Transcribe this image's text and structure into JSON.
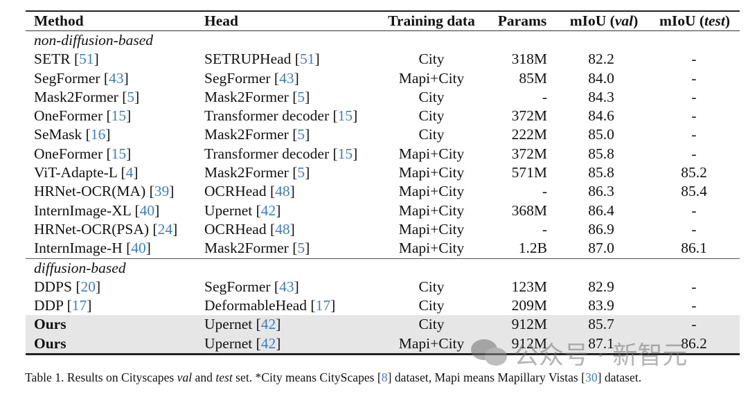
{
  "table": {
    "headers": {
      "method": "Method",
      "head": "Head",
      "training_data": "Training data",
      "params": "Params",
      "miou_val_prefix": "mIoU (",
      "miou_val_italic": "val",
      "miou_val_suffix": ")",
      "miou_test_prefix": "mIoU (",
      "miou_test_italic": "test",
      "miou_test_suffix": ")"
    },
    "groups": [
      {
        "label": "non-diffusion-based",
        "rows": [
          {
            "method": "SETR",
            "method_ref": "51",
            "head": "SETRUPHead",
            "head_ref": "51",
            "training_data": "City",
            "params": "318M",
            "miou_val": "82.2",
            "miou_test": "-"
          },
          {
            "method": "SegFormer",
            "method_ref": "43",
            "head": "SegFormer",
            "head_ref": "43",
            "training_data": "Mapi+City",
            "params": "85M",
            "miou_val": "84.0",
            "miou_test": "-"
          },
          {
            "method": "Mask2Former",
            "method_ref": "5",
            "head": "Mask2Former",
            "head_ref": "5",
            "training_data": "City",
            "params": "-",
            "miou_val": "84.3",
            "miou_test": "-"
          },
          {
            "method": "OneFormer",
            "method_ref": "15",
            "head": "Transformer decoder",
            "head_ref": "15",
            "training_data": "City",
            "params": "372M",
            "miou_val": "84.6",
            "miou_test": "-"
          },
          {
            "method": "SeMask",
            "method_ref": "16",
            "head": "Mask2Former",
            "head_ref": "5",
            "training_data": "City",
            "params": "222M",
            "miou_val": "85.0",
            "miou_test": "-"
          },
          {
            "method": "OneFormer",
            "method_ref": "15",
            "head": "Transformer decoder",
            "head_ref": "15",
            "training_data": "Mapi+City",
            "params": "372M",
            "miou_val": "85.8",
            "miou_test": "-"
          },
          {
            "method": "ViT-Adapte-L",
            "method_ref": "4",
            "head": "Mask2Former",
            "head_ref": "5",
            "training_data": "Mapi+City",
            "params": "571M",
            "miou_val": "85.8",
            "miou_test": "85.2"
          },
          {
            "method": "HRNet-OCR(MA)",
            "method_ref": "39",
            "head": "OCRHead",
            "head_ref": "48",
            "training_data": "Mapi+City",
            "params": "-",
            "miou_val": "86.3",
            "miou_test": "85.4"
          },
          {
            "method": "InternImage-XL",
            "method_ref": "40",
            "head": "Upernet",
            "head_ref": "42",
            "training_data": "Mapi+City",
            "params": "368M",
            "miou_val": "86.4",
            "miou_test": "-"
          },
          {
            "method": "HRNet-OCR(PSA)",
            "method_ref": "24",
            "head": "OCRHead",
            "head_ref": "48",
            "training_data": "Mapi+City",
            "params": "-",
            "miou_val": "86.9",
            "miou_test": "-"
          },
          {
            "method": "InternImage-H",
            "method_ref": "40",
            "head": "Mask2Former",
            "head_ref": "5",
            "training_data": "Mapi+City",
            "params": "1.2B",
            "miou_val": "87.0",
            "miou_test": "86.1"
          }
        ]
      },
      {
        "label": "diffusion-based",
        "rows": [
          {
            "method": "DDPS",
            "method_ref": "20",
            "head": "SegFormer",
            "head_ref": "43",
            "training_data": "City",
            "params": "123M",
            "miou_val": "82.9",
            "miou_test": "-"
          },
          {
            "method": "DDP",
            "method_ref": "17",
            "head": "DeformableHead",
            "head_ref": "17",
            "training_data": "City",
            "params": "209M",
            "miou_val": "83.9",
            "miou_test": "-"
          },
          {
            "method": "Ours",
            "method_ref": "",
            "head": "Upernet",
            "head_ref": "42",
            "training_data": "City",
            "params": "912M",
            "miou_val": "85.7",
            "miou_test": "-",
            "highlight": true
          },
          {
            "method": "Ours",
            "method_ref": "",
            "head": "Upernet",
            "head_ref": "42",
            "training_data": "Mapi+City",
            "params": "912M",
            "miou_val": "87.1",
            "miou_test": "86.2",
            "highlight": true
          }
        ]
      }
    ]
  },
  "caption": {
    "t1": "Table 1. Results on Cityscapes ",
    "i1": "val",
    "t2": " and ",
    "i2": "test",
    "t3": " set. *City means CityScapes [",
    "ref1": "8",
    "t4": "] dataset, Mapi means Mapillary Vistas [",
    "ref2": "30",
    "t5": "] dataset."
  },
  "watermark": {
    "icon": "wechat-icon",
    "text": "公众号 · 新智元"
  },
  "colors": {
    "citation": "#3d7ebf",
    "highlight_row": "#e6e6e6"
  }
}
